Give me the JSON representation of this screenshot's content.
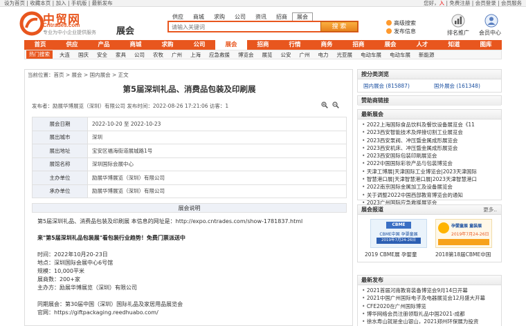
{
  "topbar": {
    "left_text": "设为首页 | 收藏本页 | 加入 | 手机版 | 最新发布",
    "greeting": "您好，",
    "user": "入",
    "right_text": " | 免费注册 | 会员登录 | 会员服务"
  },
  "header": {
    "brand": "中贸网",
    "domain": "Cntrades.com",
    "slogan": "专业为中小企业提供服务",
    "section": "展会",
    "search_tabs": [
      "供应",
      "商城",
      "求购",
      "公司",
      "资讯",
      "招商",
      "展会"
    ],
    "active_tab_index": 6,
    "search_placeholder": "请输入关键词",
    "search_button": "搜 索",
    "quick_links": [
      "高级搜索",
      "发布信息"
    ],
    "rank_label": "排名推广",
    "member_label": "会员中心"
  },
  "nav": {
    "items": [
      "首页",
      "供应",
      "产品",
      "商城",
      "求购",
      "公司",
      "展会",
      "招商",
      "行情",
      "商务",
      "招商",
      "展会",
      "人才",
      "知道",
      "图库"
    ],
    "active_index": 6
  },
  "subnav": {
    "hot_label": "热门搜索",
    "items": [
      "大连",
      "国庆",
      "安全",
      "家具",
      "公司",
      "农牧",
      "广州",
      "上海",
      "应急救援",
      "博览会",
      "展览",
      "公安",
      "广州",
      "电力",
      "光亚展",
      "电动车展",
      "电动车展",
      "新能源"
    ]
  },
  "article": {
    "breadcrumb": "当前位置：首页 > 展会 > 国内展会 > 正文",
    "title": "第5届深圳礼品、消费品包装及印刷展",
    "meta": "发布者：励展华博展览（深圳）有限公司    发布时间：2022-08-26 17:21:06    访客：1",
    "info_rows": [
      {
        "label": "展会日期",
        "value": "2022-10-20 至 2022-10-23"
      },
      {
        "label": "展出城市",
        "value": "深圳"
      },
      {
        "label": "展出地址",
        "value": "宝安区福海街道展城路1号"
      },
      {
        "label": "展馆名称",
        "value": "深圳国际会展中心"
      },
      {
        "label": "主办单位",
        "value": "励展华博展览（深圳）有限公司"
      },
      {
        "label": "承办单位",
        "value": "励展华博展览（深圳）有限公司"
      }
    ],
    "desc_title": "展会说明",
    "desc_lines": [
      "第5届深圳礼品、消费品包装及印刷展  本信息的网址是：http://expo.cntrades.com/show-1781837.html",
      "来\"第5届深圳礼品包装展\"看包装行业趋势！免费门票派送中",
      "时间：2022年10月20-23日",
      "地点：深圳国际会展中心6号馆",
      "规模：10,000平米",
      "展商数：200+家",
      "主办方：励展华博展览（深圳）有限公司",
      "同期展会：第30届中国（深圳）国际礼品及家居用品展览会",
      "官网：https://giftpackaging.reedhuabo.com/"
    ]
  },
  "sidebar": {
    "category_title": "按分类浏览",
    "domestic": "国内展会 (815887)",
    "foreign": "国外展会 (161348)",
    "sponsor_title": "赞助商链接",
    "latest_title": "最新展会",
    "latest": [
      "2022上海国际食品饮料及餐饮设备展览会《11",
      "2023西安智能技术及焊接切割工业展览会",
      "2023西安泵阀、冲压暨金属成形展览会",
      "2023西安机床、冲压暨金属成形展览会",
      "2023西安国际包装印刷展览会",
      "2022中国国际彩妆产品与包装博览会",
      "天津工博展|天津国际工业博览会|2023天津国际",
      "智慧港口展|天津智慧港口展|2023天津智慧港口",
      "2022南京国际金属加工及设备展览会",
      "关于调整2022中国西部教育博览会的通知",
      "2023广州国际应急救援展览会"
    ],
    "photo_title": "展会报道",
    "photo_more": "更多..",
    "photos": [
      "2019 CBME展 孕婴童",
      "2018第18届CBME中国"
    ],
    "banner1_text": "CBME中国 孕婴童展",
    "banner1_date": "2019年7月24-26日",
    "banner2_text": "孕婴童展 童装展",
    "banner2_date": "2019年7月24-26日",
    "news_title": "最新发布",
    "news": [
      "2021首届河南教育装备博览会9月14日开幕",
      "2021中国广州国际电子及电器展览会12月盛大开幕",
      "CFE2020在广州国际博览",
      "博华网络会员注册领取礼品中国2021-成都",
      "徐水寿山就是金山银山，2021郑州环保展为投资"
    ]
  },
  "colors": {
    "brand_orange": "#e8561e",
    "accent_blue": "#1a4fa0"
  }
}
